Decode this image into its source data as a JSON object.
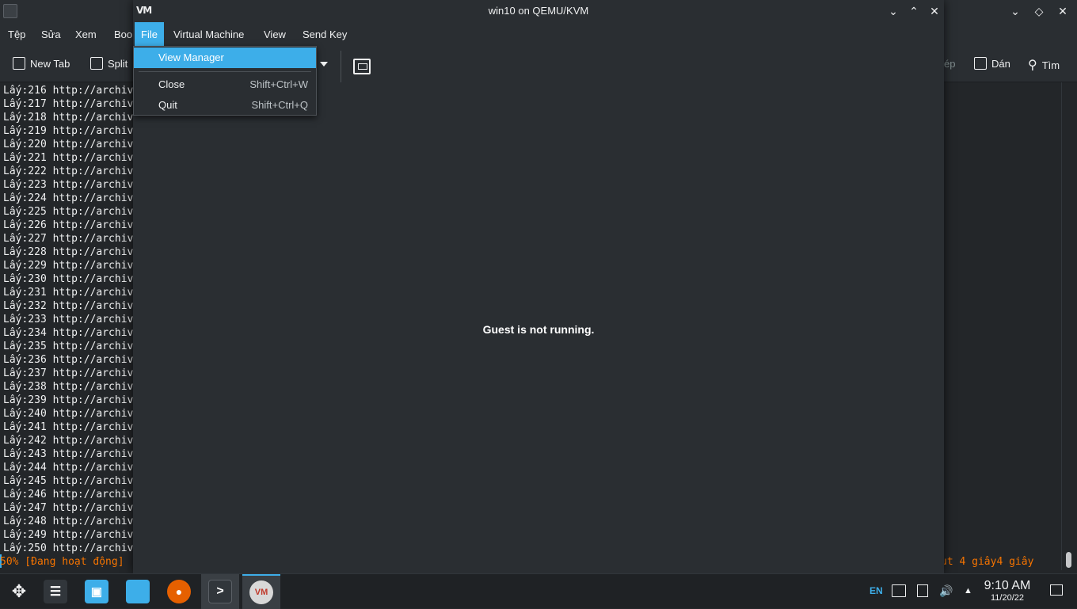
{
  "konsole": {
    "menu": [
      "Tệp",
      "Sửa",
      "Xem",
      "Boo"
    ],
    "toolbar": {
      "new_tab": "New Tab",
      "split": "Split",
      "copy": "ép",
      "paste": "Dán",
      "find": "Tìm"
    },
    "lines": [
      "Lấy:216 http://archiv",
      "Lấy:217 http://archiv",
      "Lấy:218 http://archiv",
      "Lấy:219 http://archiv",
      "Lấy:220 http://archiv",
      "Lấy:221 http://archiv",
      "Lấy:222 http://archiv",
      "Lấy:223 http://archiv",
      "Lấy:224 http://archiv",
      "Lấy:225 http://archiv",
      "Lấy:226 http://archiv",
      "Lấy:227 http://archiv",
      "Lấy:228 http://archiv",
      "Lấy:229 http://archiv",
      "Lấy:230 http://archiv",
      "Lấy:231 http://archiv",
      "Lấy:232 http://archiv",
      "Lấy:233 http://archiv",
      "Lấy:234 http://archiv",
      "Lấy:235 http://archiv",
      "Lấy:236 http://archiv",
      "Lấy:237 http://archiv",
      "Lấy:238 http://archiv",
      "Lấy:239 http://archiv",
      "Lấy:240 http://archiv",
      "Lấy:241 http://archiv",
      "Lấy:242 http://archiv",
      "Lấy:243 http://archiv",
      "Lấy:244 http://archiv",
      "Lấy:245 http://archiv",
      "Lấy:246 http://archiv",
      "Lấy:247 http://archiv",
      "Lấy:248 http://archiv",
      "Lấy:249 http://archiv",
      "Lấy:250 http://archiv"
    ],
    "status_left": "50% [Đang hoạt động]",
    "status_right": "ut 4 giây4 giây"
  },
  "viewer": {
    "logo": "VM",
    "title": "win10 on QEMU/KVM",
    "menu": [
      "File",
      "Virtual Machine",
      "View",
      "Send Key"
    ],
    "file_menu": {
      "view_manager": "View Manager",
      "close": "Close",
      "close_shortcut": "Shift+Ctrl+W",
      "quit": "Quit",
      "quit_shortcut": "Shift+Ctrl+Q"
    },
    "message": "Guest is not running."
  },
  "taskbar": {
    "apps": [
      "launcher-icon",
      "settings-icon",
      "discover-icon",
      "files-icon",
      "firefox-icon",
      "konsole-icon",
      "virt-manager-icon"
    ],
    "lang": "EN",
    "time": "9:10 AM",
    "date": "11/20/22"
  },
  "colors": {
    "accent": "#3daee9",
    "status_orange": "#f67400",
    "background": "#232629"
  }
}
